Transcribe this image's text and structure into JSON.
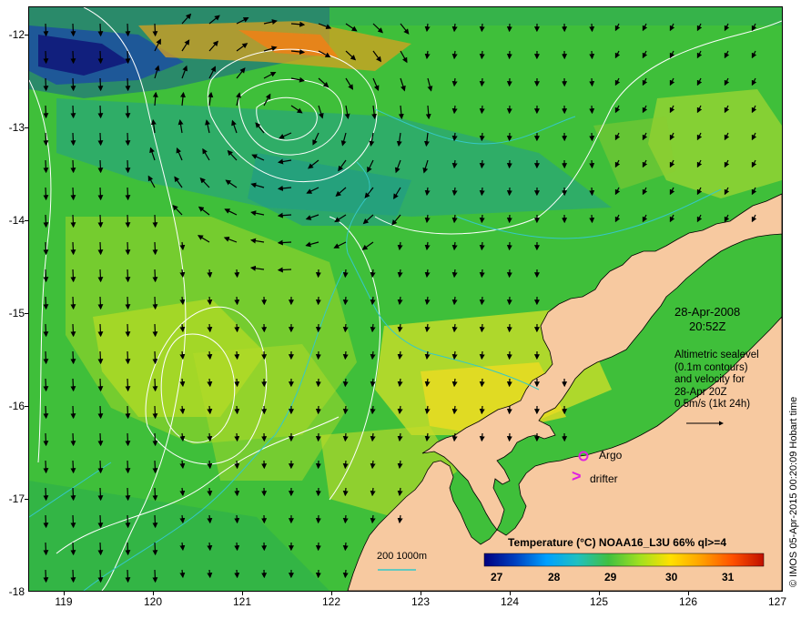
{
  "date_label": "28-Apr-2008",
  "time_label": "20:52Z",
  "legend_lines": [
    "Altimetric sealevel",
    "(0.1m contours)",
    "and velocity for",
    "28-Apr 20Z",
    "0.5m/s (1kt 24h)"
  ],
  "argo_label": "Argo",
  "drifter_label": "drifter",
  "drifter_symbol": ">",
  "depth_label": "200  1000m",
  "colorbar_title": "Temperature (°C) NOAA16_L3U 66% ql>=4",
  "colorbar_ticks": [
    "27",
    "28",
    "29",
    "30",
    "31"
  ],
  "credit": "© IMOS 05-Apr-2015 00:20:09 Hobart time",
  "lat_labels": [
    "-12",
    "-13",
    "-14",
    "-15",
    "-16",
    "-17",
    "-18"
  ],
  "lon_labels": [
    "119",
    "120",
    "121",
    "122",
    "123",
    "124",
    "125",
    "126",
    "127"
  ],
  "colors": {
    "ocean": "#3fbf3a",
    "land": "#f7c9a0",
    "contour": "#ffffff",
    "isobath": "#35c8c8",
    "marker": "#e020e0",
    "colorbar": [
      "#000080",
      "#0040c0",
      "#00a0ff",
      "#20c0c0",
      "#40c040",
      "#a0e020",
      "#ffe000",
      "#ffa000",
      "#ff5000",
      "#c01000"
    ]
  }
}
